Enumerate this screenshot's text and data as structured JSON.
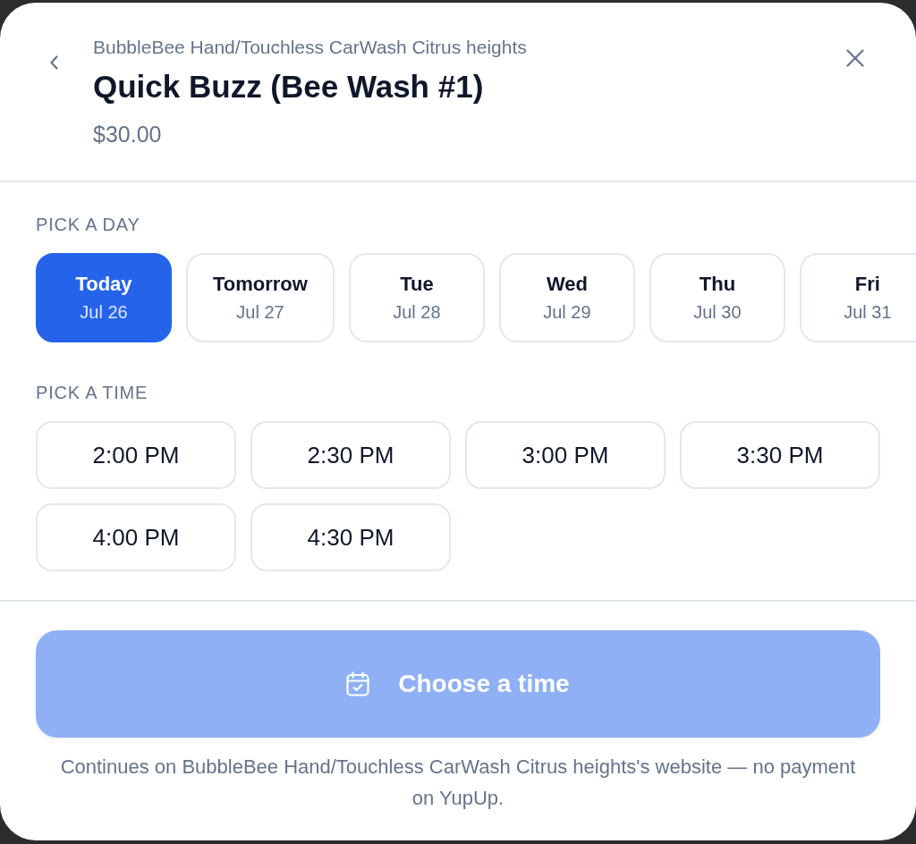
{
  "header": {
    "business": "BubbleBee Hand/Touchless CarWash Citrus heights",
    "title": "Quick Buzz (Bee Wash #1)",
    "price": "$30.00"
  },
  "day_picker": {
    "label": "PICK A DAY",
    "days": [
      {
        "name": "Today",
        "date": "Jul 26",
        "selected": true
      },
      {
        "name": "Tomorrow",
        "date": "Jul 27",
        "selected": false
      },
      {
        "name": "Tue",
        "date": "Jul 28",
        "selected": false
      },
      {
        "name": "Wed",
        "date": "Jul 29",
        "selected": false
      },
      {
        "name": "Thu",
        "date": "Jul 30",
        "selected": false
      },
      {
        "name": "Fri",
        "date": "Jul 31",
        "selected": false
      }
    ]
  },
  "time_picker": {
    "label": "PICK A TIME",
    "slots": [
      {
        "time": "2:00 PM",
        "selected": false
      },
      {
        "time": "2:30 PM",
        "selected": false
      },
      {
        "time": "3:00 PM",
        "selected": false
      },
      {
        "time": "3:30 PM",
        "selected": false
      },
      {
        "time": "4:00 PM",
        "selected": false
      },
      {
        "time": "4:30 PM",
        "selected": false
      }
    ]
  },
  "action": {
    "label": "Choose a time",
    "disabled": true
  },
  "footnote": "Continues on BubbleBee Hand/Touchless CarWash Citrus heights's website — no payment on YupUp."
}
